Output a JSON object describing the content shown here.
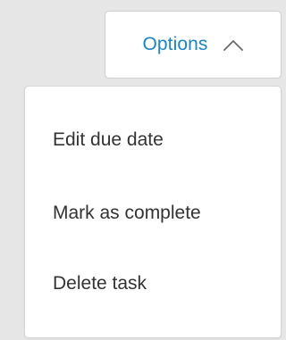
{
  "options_button": {
    "label": "Options",
    "icon": "chevron-up-icon",
    "color": "#1b85c6",
    "expanded": true
  },
  "menu": {
    "items": [
      {
        "label": "Edit due date"
      },
      {
        "label": "Mark as complete"
      },
      {
        "label": "Delete task"
      }
    ]
  }
}
